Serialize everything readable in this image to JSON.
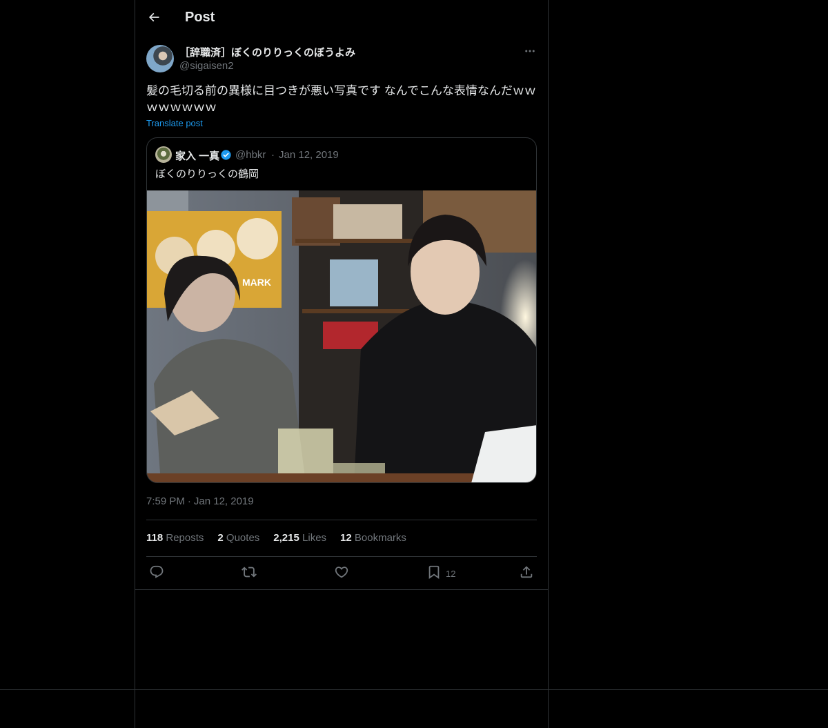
{
  "header": {
    "title": "Post"
  },
  "post": {
    "author_name": "［辞職済］ぼくのりりっくのぼうよみ",
    "author_handle": "@sigaisen2",
    "text": "髪の毛切る前の異様に目つきが悪い写真です なんでこんな表情なんだｗｗｗｗｗｗｗｗ",
    "translate_label": "Translate post",
    "time": "7:59 PM",
    "date": "Jan 12, 2019"
  },
  "quote": {
    "author_name": "家入 一真",
    "author_handle": "@hbkr",
    "separator": "·",
    "date": "Jan 12, 2019",
    "text": "ぼくのりりっくの鶴岡",
    "photo_sign_text": "MARK"
  },
  "stats": {
    "reposts_count": "118",
    "reposts_label": "Reposts",
    "quotes_count": "2",
    "quotes_label": "Quotes",
    "likes_count": "2,215",
    "likes_label": "Likes",
    "bookmarks_count": "12",
    "bookmarks_label": "Bookmarks"
  },
  "actions": {
    "bookmark_count": "12"
  },
  "colors": {
    "background": "#000000",
    "text": "#e7e9ea",
    "secondary": "#71767b",
    "link": "#1d9bf0",
    "border": "#2f3336"
  },
  "icons": [
    "back-arrow-icon",
    "more-icon",
    "verified-icon",
    "reply-icon",
    "repost-icon",
    "like-icon",
    "bookmark-icon",
    "share-icon"
  ]
}
